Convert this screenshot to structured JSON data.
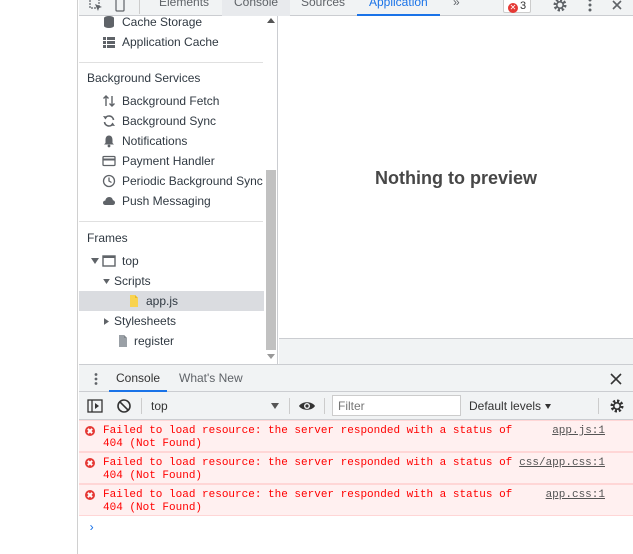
{
  "top_tabs": {
    "elements": "Elements",
    "console": "Console",
    "sources": "Sources",
    "application": "Application",
    "more": "»",
    "error_count": "3"
  },
  "sidebar": {
    "cache_items": [
      {
        "label": "Cache Storage",
        "icon": "database-icon"
      },
      {
        "label": "Application Cache",
        "icon": "grid-icon"
      }
    ],
    "background_services_header": "Background Services",
    "background_services": [
      {
        "label": "Background Fetch",
        "icon": "arrows-updown-icon"
      },
      {
        "label": "Background Sync",
        "icon": "sync-icon"
      },
      {
        "label": "Notifications",
        "icon": "bell-icon"
      },
      {
        "label": "Payment Handler",
        "icon": "card-icon"
      },
      {
        "label": "Periodic Background Sync",
        "icon": "clock-icon"
      },
      {
        "label": "Push Messaging",
        "icon": "cloud-icon"
      }
    ],
    "frames_header": "Frames",
    "frames": {
      "top": "top",
      "scripts": "Scripts",
      "appjs": "app.js",
      "stylesheets": "Stylesheets",
      "register": "register"
    }
  },
  "preview": {
    "message": "Nothing to preview"
  },
  "drawer": {
    "tabs": [
      "Console",
      "What's New"
    ],
    "toolbar": {
      "context": "top",
      "filter_placeholder": "Filter",
      "levels": "Default levels"
    },
    "messages": [
      {
        "text": "Failed to load resource: the server responded with a status of 404 (Not Found)",
        "source": "app.js:1"
      },
      {
        "text": "Failed to load resource: the server responded with a status of 404 (Not Found)",
        "source": "css/app.css:1"
      },
      {
        "text": "Failed to load resource: the server responded with a status of 404 (Not Found)",
        "source": "app.css:1"
      }
    ],
    "prompt": "›"
  },
  "colors": {
    "accent": "#1a73e8",
    "error": "#ff0000",
    "error_bg": "#fff0f0"
  }
}
